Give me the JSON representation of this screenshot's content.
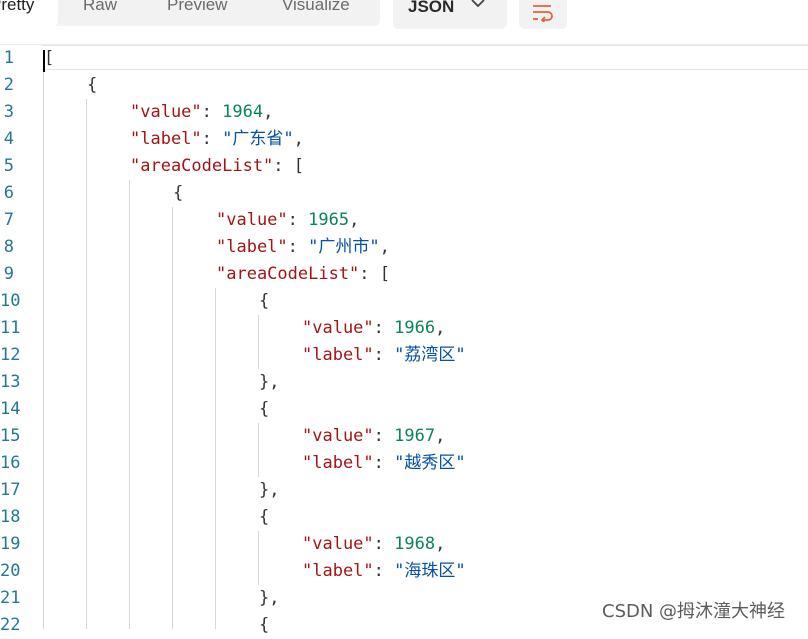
{
  "toolbar": {
    "tabs": [
      {
        "label": "Pretty",
        "active": true
      },
      {
        "label": "Raw",
        "active": false
      },
      {
        "label": "Preview",
        "active": false
      },
      {
        "label": "Visualize",
        "active": false
      }
    ],
    "format": "JSON",
    "format_icon": "chevron-down-icon",
    "wrap_icon": "wrap-lines-icon",
    "accent_color": "#e8613c"
  },
  "editor": {
    "lines": [
      {
        "n": "1",
        "indent": 0,
        "tokens": [
          {
            "t": "p",
            "v": "["
          }
        ]
      },
      {
        "n": "2",
        "indent": 1,
        "tokens": [
          {
            "t": "p",
            "v": "{"
          }
        ]
      },
      {
        "n": "3",
        "indent": 2,
        "tokens": [
          {
            "t": "k",
            "v": "\"value\""
          },
          {
            "t": "p",
            "v": ": "
          },
          {
            "t": "n",
            "v": "1964"
          },
          {
            "t": "p",
            "v": ","
          }
        ]
      },
      {
        "n": "4",
        "indent": 2,
        "tokens": [
          {
            "t": "k",
            "v": "\"label\""
          },
          {
            "t": "p",
            "v": ": "
          },
          {
            "t": "s",
            "v": "\"广东省\""
          },
          {
            "t": "p",
            "v": ","
          }
        ]
      },
      {
        "n": "5",
        "indent": 2,
        "tokens": [
          {
            "t": "k",
            "v": "\"areaCodeList\""
          },
          {
            "t": "p",
            "v": ": ["
          }
        ]
      },
      {
        "n": "6",
        "indent": 3,
        "tokens": [
          {
            "t": "p",
            "v": "{"
          }
        ]
      },
      {
        "n": "7",
        "indent": 4,
        "tokens": [
          {
            "t": "k",
            "v": "\"value\""
          },
          {
            "t": "p",
            "v": ": "
          },
          {
            "t": "n",
            "v": "1965"
          },
          {
            "t": "p",
            "v": ","
          }
        ]
      },
      {
        "n": "8",
        "indent": 4,
        "tokens": [
          {
            "t": "k",
            "v": "\"label\""
          },
          {
            "t": "p",
            "v": ": "
          },
          {
            "t": "s",
            "v": "\"广州市\""
          },
          {
            "t": "p",
            "v": ","
          }
        ]
      },
      {
        "n": "9",
        "indent": 4,
        "tokens": [
          {
            "t": "k",
            "v": "\"areaCodeList\""
          },
          {
            "t": "p",
            "v": ": ["
          }
        ]
      },
      {
        "n": "10",
        "indent": 5,
        "tokens": [
          {
            "t": "p",
            "v": "{"
          }
        ]
      },
      {
        "n": "11",
        "indent": 6,
        "tokens": [
          {
            "t": "k",
            "v": "\"value\""
          },
          {
            "t": "p",
            "v": ": "
          },
          {
            "t": "n",
            "v": "1966"
          },
          {
            "t": "p",
            "v": ","
          }
        ]
      },
      {
        "n": "12",
        "indent": 6,
        "tokens": [
          {
            "t": "k",
            "v": "\"label\""
          },
          {
            "t": "p",
            "v": ": "
          },
          {
            "t": "s",
            "v": "\"荔湾区\""
          }
        ]
      },
      {
        "n": "13",
        "indent": 5,
        "tokens": [
          {
            "t": "p",
            "v": "},"
          }
        ]
      },
      {
        "n": "14",
        "indent": 5,
        "tokens": [
          {
            "t": "p",
            "v": "{"
          }
        ]
      },
      {
        "n": "15",
        "indent": 6,
        "tokens": [
          {
            "t": "k",
            "v": "\"value\""
          },
          {
            "t": "p",
            "v": ": "
          },
          {
            "t": "n",
            "v": "1967"
          },
          {
            "t": "p",
            "v": ","
          }
        ]
      },
      {
        "n": "16",
        "indent": 6,
        "tokens": [
          {
            "t": "k",
            "v": "\"label\""
          },
          {
            "t": "p",
            "v": ": "
          },
          {
            "t": "s",
            "v": "\"越秀区\""
          }
        ]
      },
      {
        "n": "17",
        "indent": 5,
        "tokens": [
          {
            "t": "p",
            "v": "},"
          }
        ]
      },
      {
        "n": "18",
        "indent": 5,
        "tokens": [
          {
            "t": "p",
            "v": "{"
          }
        ]
      },
      {
        "n": "19",
        "indent": 6,
        "tokens": [
          {
            "t": "k",
            "v": "\"value\""
          },
          {
            "t": "p",
            "v": ": "
          },
          {
            "t": "n",
            "v": "1968"
          },
          {
            "t": "p",
            "v": ","
          }
        ]
      },
      {
        "n": "20",
        "indent": 6,
        "tokens": [
          {
            "t": "k",
            "v": "\"label\""
          },
          {
            "t": "p",
            "v": ": "
          },
          {
            "t": "s",
            "v": "\"海珠区\""
          }
        ]
      },
      {
        "n": "21",
        "indent": 5,
        "tokens": [
          {
            "t": "p",
            "v": "},"
          }
        ]
      },
      {
        "n": "22",
        "indent": 5,
        "tokens": [
          {
            "t": "p",
            "v": "{"
          }
        ]
      }
    ]
  },
  "watermark": "CSDN @拇沐潼大神经"
}
